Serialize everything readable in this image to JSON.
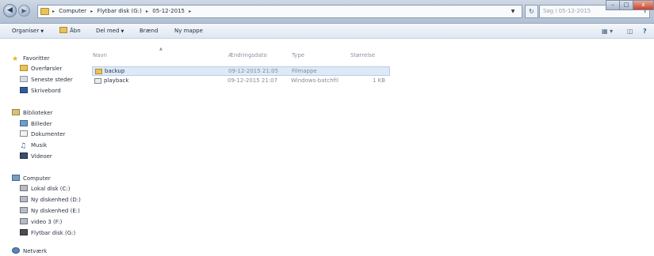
{
  "window": {
    "breadcrumbs": [
      "Computer",
      "Flytbar disk (G:)",
      "05-12-2015"
    ],
    "search_placeholder": "Søg i 05-12-2015",
    "buttons": {
      "minimize": "–",
      "maximize": "□",
      "close": "x"
    }
  },
  "toolbar": {
    "organize": "Organiser",
    "open": "Åbn",
    "share": "Del med",
    "burn": "Brænd",
    "new_folder": "Ny mappe"
  },
  "sidebar": {
    "favorites": {
      "header": "Favoritter",
      "items": [
        "Overførsler",
        "Seneste steder",
        "Skrivebord"
      ]
    },
    "libraries": {
      "header": "Biblioteker",
      "items": [
        "Billeder",
        "Dokumenter",
        "Musik",
        "Videoer"
      ]
    },
    "computer": {
      "header": "Computer",
      "items": [
        "Lokal disk (C:)",
        "Ny diskenhed (D:)",
        "Ny diskenhed (E:)",
        "video 3 (F:)",
        "Flytbar disk (G:)"
      ]
    },
    "network": {
      "header": "Netværk"
    }
  },
  "files": {
    "columns": {
      "name": "Navn",
      "modified": "Ændringsdato",
      "type": "Type",
      "size": "Størrelse"
    },
    "rows": [
      {
        "name": "backup",
        "modified": "09-12-2015 21:05",
        "type": "Filmappe",
        "size": "",
        "icon": "folder-icon",
        "selected": true
      },
      {
        "name": "playback",
        "modified": "09-12-2015 21:07",
        "type": "Windows-batchfil",
        "size": "1 KB",
        "icon": "batch-file-icon",
        "selected": false
      }
    ]
  }
}
